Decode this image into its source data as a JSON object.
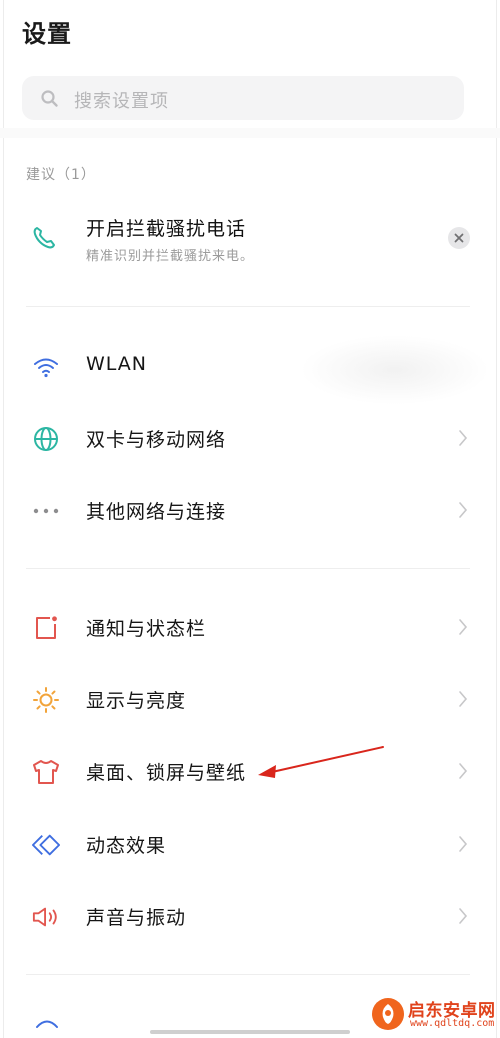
{
  "page": {
    "title": "设置"
  },
  "search": {
    "placeholder": "搜索设置项"
  },
  "suggestions": {
    "label": "建议（1）",
    "item": {
      "title": "开启拦截骚扰电话",
      "subtitle": "精准识别并拦截骚扰来电。",
      "icon": "phone-icon"
    }
  },
  "network": [
    {
      "label": "WLAN",
      "icon": "wifi-icon"
    },
    {
      "label": "双卡与移动网络",
      "icon": "globe-icon"
    },
    {
      "label": "其他网络与连接",
      "icon": "more-dots-icon"
    }
  ],
  "display": [
    {
      "label": "通知与状态栏",
      "icon": "notification-icon"
    },
    {
      "label": "显示与亮度",
      "icon": "brightness-icon"
    },
    {
      "label": "桌面、锁屏与壁纸",
      "icon": "tshirt-icon"
    },
    {
      "label": "动态效果",
      "icon": "diamond-icon"
    },
    {
      "label": "声音与振动",
      "icon": "speaker-icon"
    }
  ],
  "watermark": {
    "title": "启东安卓网",
    "url": "www.qdltdq.com"
  },
  "colors": {
    "accent": "#3f6ee0",
    "green": "#2cb6a3",
    "red": "#e2564f",
    "orange": "#f2a43a",
    "annotation": "#d9261c"
  }
}
